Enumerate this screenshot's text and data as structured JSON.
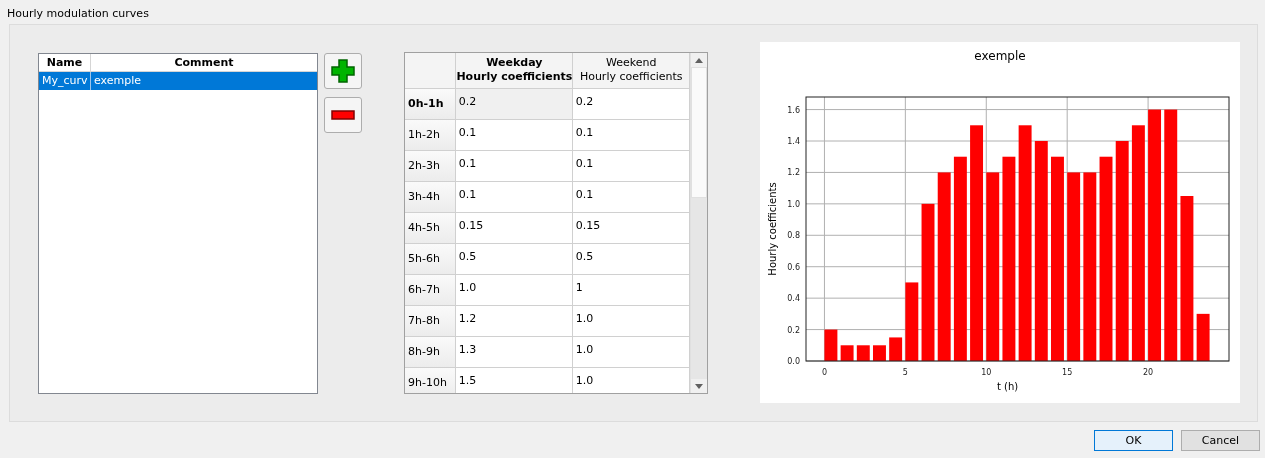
{
  "window": {
    "title": "Hourly modulation curves"
  },
  "curves": {
    "columns": [
      "Name",
      "Comment"
    ],
    "rows": [
      {
        "name": "My_curv",
        "comment": "exemple",
        "selected": true
      }
    ]
  },
  "buttons": {
    "add": {
      "kind": "add"
    },
    "remove": {
      "kind": "remove"
    }
  },
  "coefficients": {
    "columns": [
      {
        "line1": "Weekday",
        "line2": "Hourly coefficients",
        "bold": true
      },
      {
        "line1": "Weekend",
        "line2": "Hourly coefficients",
        "bold": false
      }
    ],
    "rows": [
      {
        "hour": "0h-1h",
        "weekday": "0.2",
        "weekend": "0.2",
        "selected": true
      },
      {
        "hour": "1h-2h",
        "weekday": "0.1",
        "weekend": "0.1",
        "selected": false
      },
      {
        "hour": "2h-3h",
        "weekday": "0.1",
        "weekend": "0.1",
        "selected": false
      },
      {
        "hour": "3h-4h",
        "weekday": "0.1",
        "weekend": "0.1",
        "selected": false
      },
      {
        "hour": "4h-5h",
        "weekday": "0.15",
        "weekend": "0.15",
        "selected": false
      },
      {
        "hour": "5h-6h",
        "weekday": "0.5",
        "weekend": "0.5",
        "selected": false
      },
      {
        "hour": "6h-7h",
        "weekday": "1.0",
        "weekend": "1",
        "selected": false
      },
      {
        "hour": "7h-8h",
        "weekday": "1.2",
        "weekend": "1.0",
        "selected": false
      },
      {
        "hour": "8h-9h",
        "weekday": "1.3",
        "weekend": "1.0",
        "selected": false
      },
      {
        "hour": "9h-10h",
        "weekday": "1.5",
        "weekend": "1.0",
        "selected": false
      }
    ]
  },
  "chart": {
    "chart_data": {
      "type": "bar",
      "title": "exemple",
      "xlabel": "t (h)",
      "ylabel": "Hourly coefficients",
      "x": [
        0.4,
        1.4,
        2.4,
        3.4,
        4.4,
        5.4,
        6.4,
        7.4,
        8.4,
        9.4,
        10.4,
        11.4,
        12.4,
        13.4,
        14.4,
        15.4,
        16.4,
        17.4,
        18.4,
        19.4,
        20.4,
        21.4,
        22.4,
        23.4
      ],
      "grid": true,
      "series": [
        {
          "color": "#ff0000",
          "values": [
            0.2,
            0.1,
            0.1,
            0.1,
            0.15,
            0.5,
            1.0,
            1.2,
            1.3,
            1.5,
            1.2,
            1.3,
            1.5,
            1.4,
            1.3,
            1.2,
            1.2,
            1.3,
            1.4,
            1.5,
            1.6,
            1.6,
            1.05,
            0.3
          ]
        }
      ],
      "xlim": [
        -1.14,
        25.0
      ],
      "ylim": [
        0,
        1.68
      ],
      "xticks": [
        0,
        5,
        10,
        15,
        20
      ],
      "yticks": [
        {
          "value": 0,
          "label": "0.0"
        },
        {
          "value": 0.2,
          "label": "0.2"
        },
        {
          "value": 0.4,
          "label": "0.4"
        },
        {
          "value": 0.6,
          "label": "0.6"
        },
        {
          "value": 0.8,
          "label": "0.8"
        },
        {
          "value": 1,
          "label": "1.0"
        },
        {
          "value": 1.2,
          "label": "1.2"
        },
        {
          "value": 1.4,
          "label": "1.4"
        },
        {
          "value": 1.6,
          "label": "1.6"
        }
      ]
    }
  },
  "dialog_buttons": [
    "OK",
    "Cancel"
  ]
}
